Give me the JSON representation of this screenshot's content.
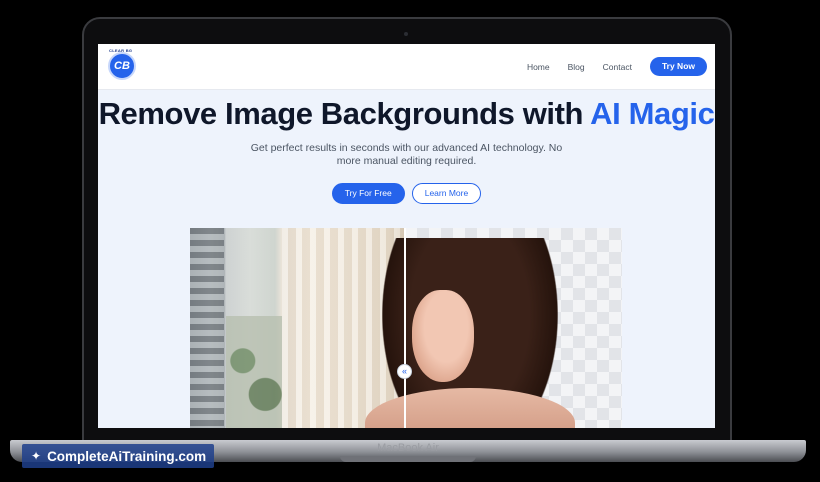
{
  "device": {
    "label": "MacBook Air"
  },
  "nav": {
    "logo_ring_text": "CLEAR BG",
    "logo_initials": "CB",
    "logo_subtext": "",
    "links": [
      "Home",
      "Blog",
      "Contact"
    ],
    "cta": "Try Now"
  },
  "hero": {
    "title_main": "Remove Image Backgrounds with ",
    "title_accent": "AI Magic",
    "subtitle": "Get perfect results in seconds with our advanced AI technology. No more manual editing required.",
    "primary_cta": "Try For Free",
    "secondary_cta": "Learn More"
  },
  "compare": {
    "handle_glyph": "«"
  },
  "watermark": {
    "icon": "sparkle-icon",
    "glyph": "✦",
    "text": "CompleteAiTraining.com"
  },
  "colors": {
    "accent": "#2563eb",
    "title": "#0f172a",
    "watermark_bg": "#1e408c"
  }
}
